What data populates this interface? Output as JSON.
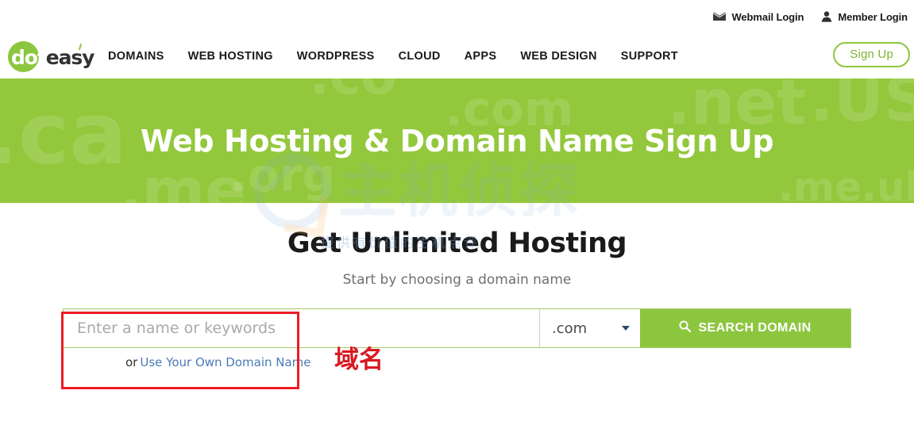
{
  "topbar": {
    "links": [
      {
        "label": "Webmail Login",
        "icon": "envelope-icon"
      },
      {
        "label": "Member Login",
        "icon": "person-icon"
      }
    ]
  },
  "brand": {
    "logo_dot": "dot",
    "logo_easy": "easy",
    "logo_full": "doteasy",
    "green": "#8CC63F"
  },
  "nav": {
    "items": [
      {
        "label": "DOMAINS"
      },
      {
        "label": "WEB HOSTING"
      },
      {
        "label": "WORDPRESS"
      },
      {
        "label": "CLOUD"
      },
      {
        "label": "APPS"
      },
      {
        "label": "WEB DESIGN"
      },
      {
        "label": "SUPPORT"
      }
    ],
    "signup_label": "Sign Up"
  },
  "hero": {
    "title": "Web Hosting & Domain Name Sign Up",
    "background": "#93C83D",
    "watermarks": [
      ".ca",
      ".co",
      ".com",
      ".net",
      ".US",
      ".me",
      ".me.uk",
      ".org"
    ]
  },
  "site_watermark": {
    "text": "主机侦探",
    "subtitle": "提供有价值的主机点评"
  },
  "main": {
    "title": "Get Unlimited Hosting",
    "subtitle": "Start by choosing a domain name"
  },
  "search": {
    "placeholder": "Enter a name or keywords",
    "value": "",
    "tld_selected": ".com",
    "button_label": "SEARCH DOMAIN",
    "button_icon": "search-icon",
    "or_prefix": "or",
    "or_link_label": "Use Your Own Domain Name"
  },
  "annotations": {
    "box_color": "#ED1C24",
    "chinese_label": "域名"
  }
}
